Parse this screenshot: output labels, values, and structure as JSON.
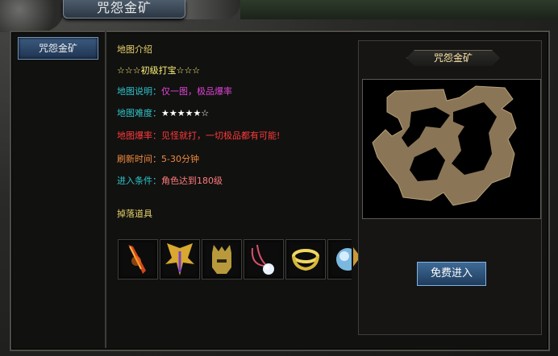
{
  "window": {
    "title": "咒怨金矿"
  },
  "sidebar": {
    "items": [
      {
        "label": "咒怨金矿"
      }
    ]
  },
  "info": {
    "section_title": "地图介绍",
    "stars_line": "☆☆☆初级打宝☆☆☆",
    "description": {
      "label": "地图说明：",
      "value": "仅一图，极品爆率"
    },
    "difficulty": {
      "label": "地图难度：",
      "value": "★★★★★☆"
    },
    "drop_rate": {
      "label": "地图爆率：",
      "value": "见怪就打，一切极品都有可能!"
    },
    "refresh": {
      "label": "刷新时间：",
      "value": "5-30分钟"
    },
    "requirement": {
      "label": "进入条件：",
      "value": "角色达到180级"
    },
    "drops_title": "掉落道具"
  },
  "drops": [
    {
      "icon": "flame-sword-icon"
    },
    {
      "icon": "golden-wings-icon"
    },
    {
      "icon": "golden-helmet-icon"
    },
    {
      "icon": "orb-necklace-icon"
    },
    {
      "icon": "golden-bracelet-icon"
    },
    {
      "icon": "blue-orb-icon"
    }
  ],
  "map_panel": {
    "title": "咒怨金矿",
    "enter_label": "免费进入"
  },
  "colors": {
    "label": "#2fc4c8",
    "section_title": "#e8d26a",
    "button": "#2e4f75"
  }
}
